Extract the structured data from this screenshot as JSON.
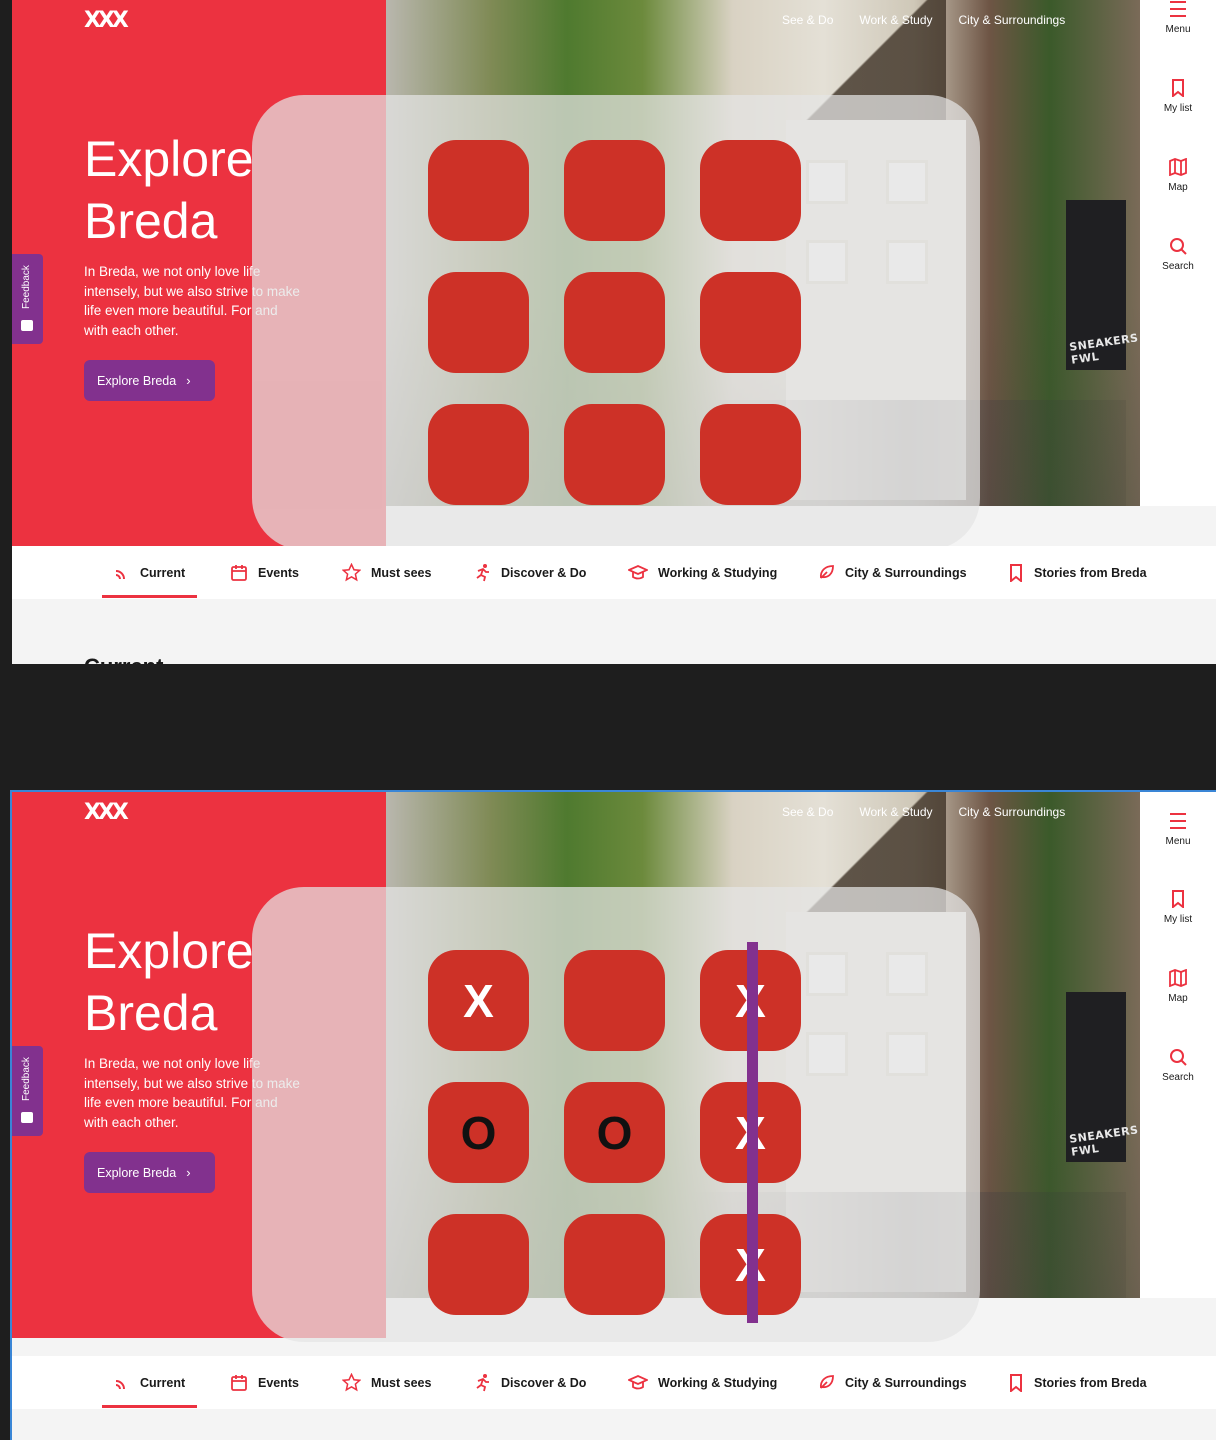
{
  "brand": {
    "logo_text": "XXX",
    "accent": "#ec3240",
    "purple": "#82318e",
    "cell_color": "#cd3127"
  },
  "top_links": [
    "See & Do",
    "Work & Study",
    "City & Surroundings"
  ],
  "side_rail": [
    {
      "label": "Menu",
      "icon": "menu-icon"
    },
    {
      "label": "My list",
      "icon": "bookmark-icon"
    },
    {
      "label": "Map",
      "icon": "map-icon"
    },
    {
      "label": "Search",
      "icon": "search-icon"
    }
  ],
  "hero": {
    "title": "Explore\nBreda",
    "text": "In Breda, we not only love life intensely, but we also strive to make life even more beautiful. For and with each other.",
    "button_label": "Explore Breda",
    "photo_sign": "SNEAKERS FWL"
  },
  "feedback_label": "Feedback",
  "nav": [
    {
      "label": "Current",
      "icon": "rss-icon",
      "active": true
    },
    {
      "label": "Events",
      "icon": "calendar-icon"
    },
    {
      "label": "Must sees",
      "icon": "star-icon"
    },
    {
      "label": "Discover & Do",
      "icon": "runner-icon"
    },
    {
      "label": "Working & Studying",
      "icon": "graduation-cap-icon"
    },
    {
      "label": "City & Surroundings",
      "icon": "leaf-icon"
    },
    {
      "label": "Stories from Breda",
      "icon": "bookmark-icon"
    }
  ],
  "section_title": "Current",
  "game_before": {
    "board": [
      "",
      "",
      "",
      "",
      "",
      "",
      "",
      "",
      ""
    ]
  },
  "game_after": {
    "board": [
      "X",
      "",
      "X",
      "O",
      "O",
      "X",
      "",
      "",
      "X"
    ],
    "winning_line": "right column"
  }
}
